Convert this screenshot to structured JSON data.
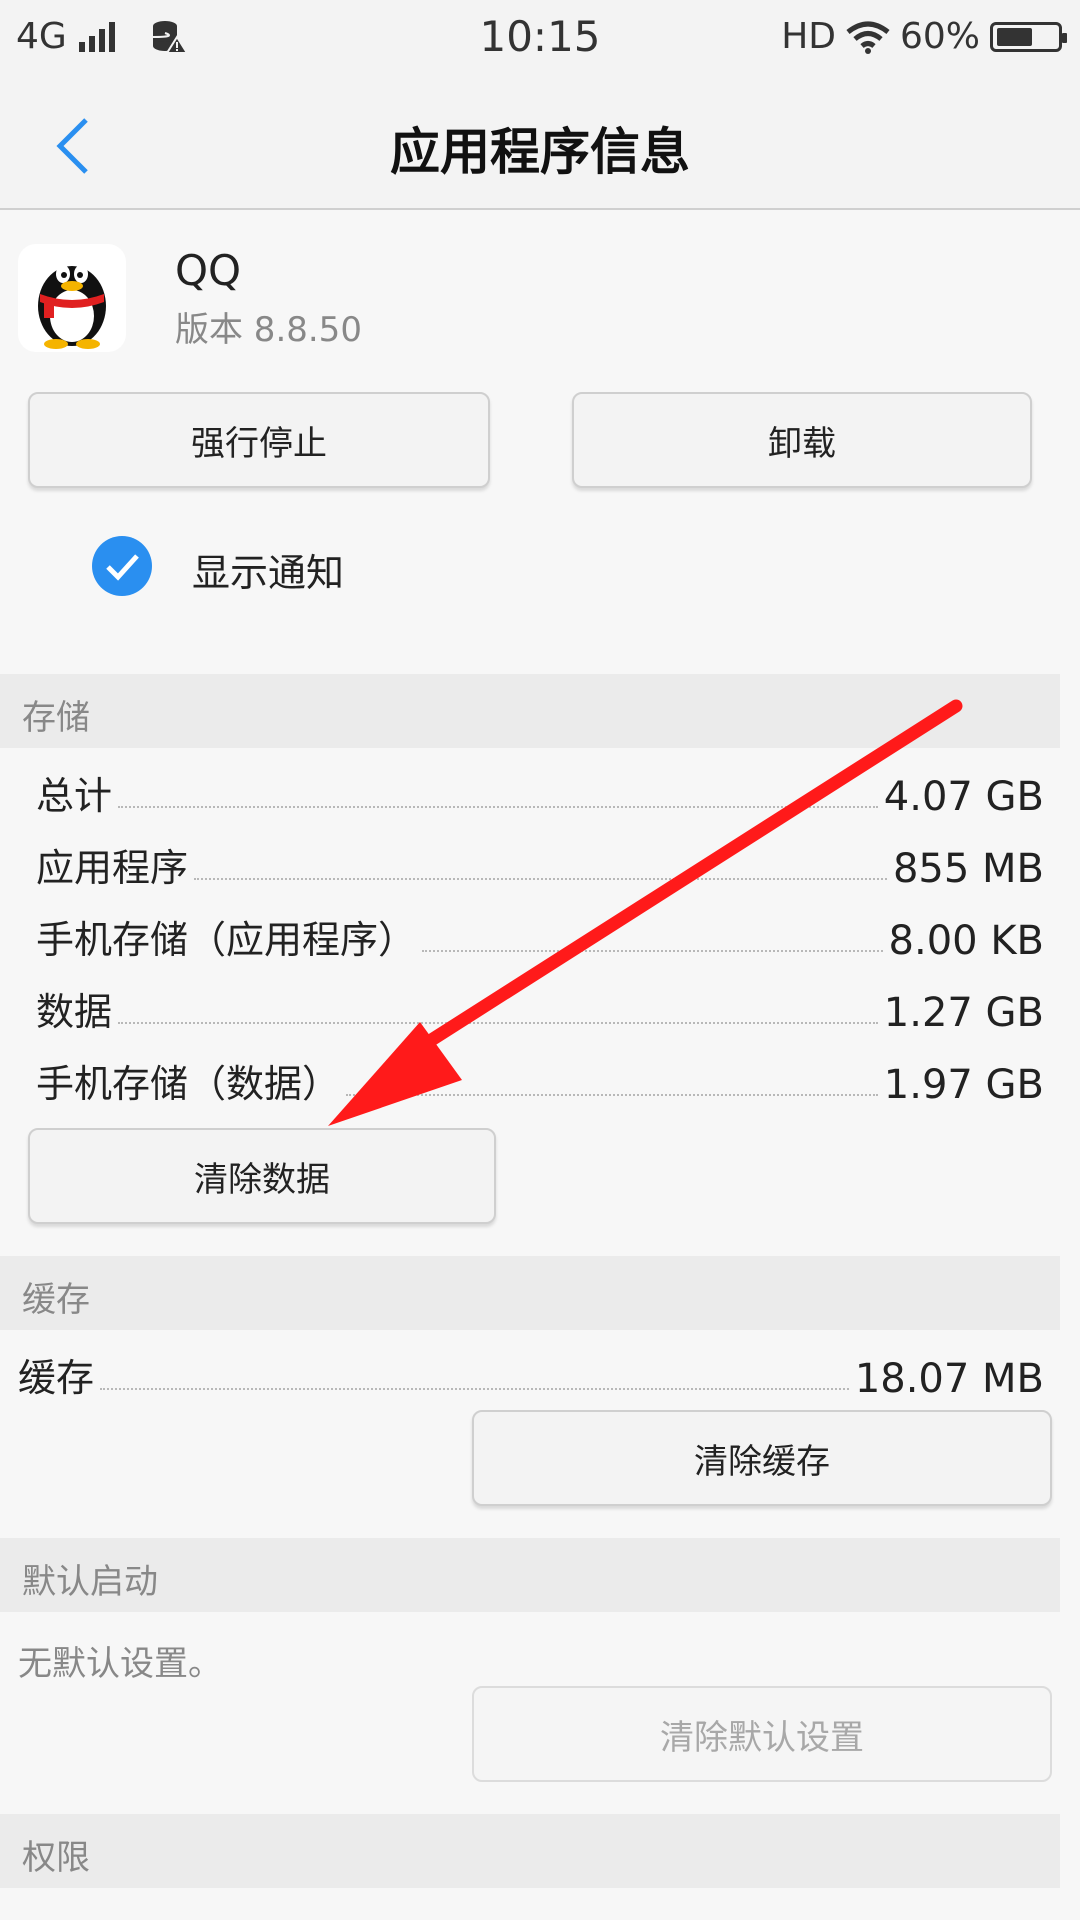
{
  "status_bar": {
    "network": "4G",
    "time": "10:15",
    "hd": "HD",
    "battery": "60%",
    "battery_level": 0.6
  },
  "header": {
    "title": "应用程序信息"
  },
  "app": {
    "name": "QQ",
    "version": "版本 8.8.50"
  },
  "actions": {
    "force_stop": "强行停止",
    "uninstall": "卸载"
  },
  "notification": {
    "label": "显示通知",
    "checked": true
  },
  "storage": {
    "section_title": "存储",
    "rows": [
      {
        "label": "总计",
        "value": "4.07 GB"
      },
      {
        "label": "应用程序",
        "value": "855 MB"
      },
      {
        "label": "手机存储（应用程序）",
        "value": "8.00 KB"
      },
      {
        "label": "数据",
        "value": "1.27 GB"
      },
      {
        "label": "手机存储（数据）",
        "value": "1.97 GB"
      }
    ],
    "clear_button": "清除数据"
  },
  "cache": {
    "section_title": "缓存",
    "label": "缓存",
    "value": "18.07 MB",
    "clear_button": "清除缓存"
  },
  "default_launch": {
    "section_title": "默认启动",
    "text": "无默认设置。",
    "clear_button": "清除默认设置"
  },
  "permissions": {
    "section_title": "权限"
  },
  "colors": {
    "accent": "#2a8ff0",
    "annotation_arrow": "#ff1a1a"
  }
}
